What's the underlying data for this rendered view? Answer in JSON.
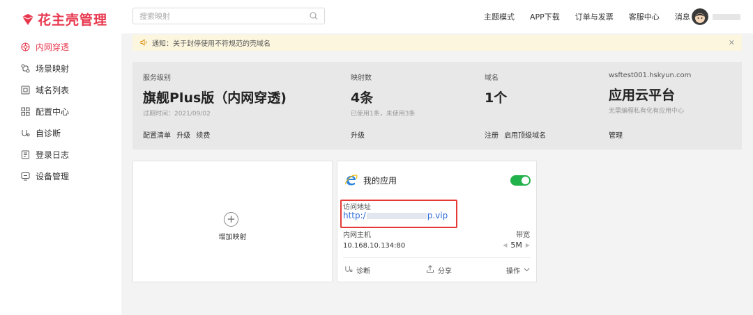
{
  "brand": {
    "name": "花主壳管理",
    "color": "#e8384f"
  },
  "sidebar": {
    "items": [
      {
        "label": "内网穿透",
        "icon": "network-icon",
        "active": true
      },
      {
        "label": "场景映射",
        "icon": "scene-icon",
        "active": false
      },
      {
        "label": "域名列表",
        "icon": "domain-icon",
        "active": false
      },
      {
        "label": "配置中心",
        "icon": "grid-icon",
        "active": false
      },
      {
        "label": "自诊断",
        "icon": "diagnose-icon",
        "active": false
      },
      {
        "label": "登录日志",
        "icon": "log-icon",
        "active": false
      },
      {
        "label": "设备管理",
        "icon": "device-icon",
        "active": false
      }
    ]
  },
  "header": {
    "search_placeholder": "搜索映射",
    "links": [
      "主题模式",
      "APP下载",
      "订单与发票",
      "客服中心",
      "消息"
    ]
  },
  "notice": {
    "text": "通知：关于封停使用不符规范的壳域名"
  },
  "summary": {
    "service": {
      "label": "服务级别",
      "value": "旗舰Plus版（内网穿透)",
      "sub": "过期时间：2021/09/02",
      "actions": [
        "配置清单",
        "升级",
        "续费"
      ]
    },
    "mappings": {
      "label": "映射数",
      "value": "4条",
      "sub": "已使用1条，未使用3条",
      "actions": [
        "升级"
      ]
    },
    "domains": {
      "label": "域名",
      "value": "1个",
      "sub": "",
      "actions": [
        "注册",
        "启用顶级域名"
      ]
    },
    "cloud": {
      "label": "wsftest001.hskyun.com",
      "value": "应用云平台",
      "sub": "无需编程私有化有应用中心",
      "actions": [
        "管理"
      ]
    }
  },
  "add_card": {
    "label": "增加映射"
  },
  "app_card": {
    "title": "我的应用",
    "enabled": true,
    "address_label": "访问地址",
    "address_prefix": "http:/",
    "address_suffix": "p.vip",
    "host_label": "内网主机",
    "host_value": "10.168.10.134:80",
    "bandwidth_label": "带宽",
    "bandwidth_value": "5M",
    "diagnose_label": "诊断",
    "share_label": "分享",
    "ops_label": "操作"
  },
  "colors": {
    "toggle_on": "#22b24c",
    "highlight_border": "#e53935",
    "link": "#2a6ad6"
  }
}
